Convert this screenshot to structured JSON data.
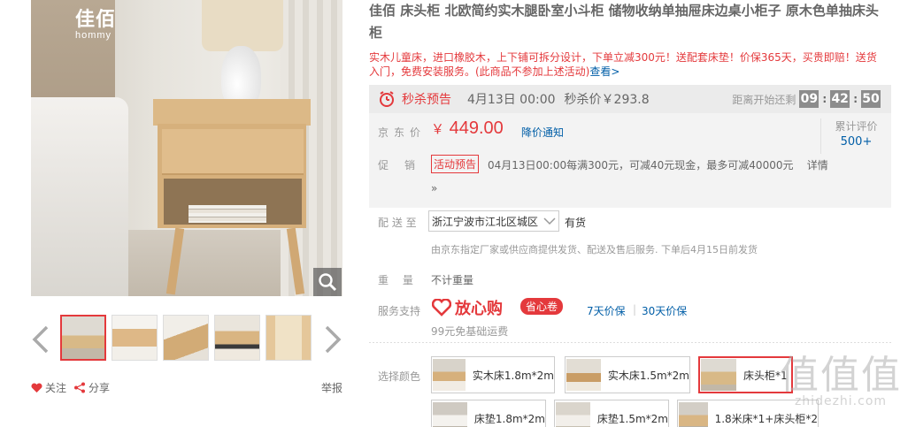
{
  "gallery": {
    "brand_cn": "佳佰",
    "brand_en": "hommy",
    "zoom_icon": "magnifier-icon",
    "prev_icon": "chevron-left-icon",
    "next_icon": "chevron-right-icon"
  },
  "actions": {
    "follow_label": "关注",
    "share_label": "分享",
    "report_label": "举报"
  },
  "product": {
    "title": "佳佰 床头柜 北欧简约实木腿卧室小斗柜 储物收纳单抽屉床边桌小柜子 原木色单抽床头柜",
    "promo_text": "实木儿童床，进口橡胶木，上下铺可拆分设计，下单立减300元！送配套床垫！价保365天，买贵即赔！送货入门，免费安装服务。(此商品不参加上述活动)",
    "promo_link": "查看>"
  },
  "seckill": {
    "label": "秒杀预告",
    "time": "4月13日 00:00",
    "price": "秒杀价￥293.8",
    "countdown_label": "距离开始还剩",
    "hours": "09",
    "minutes": "42",
    "seconds": "50"
  },
  "price": {
    "label": "京东价",
    "currency": "￥",
    "value": "449.00",
    "notify": "降价通知",
    "review_label": "累计评价",
    "review_count": "500+"
  },
  "promotion": {
    "label": "促销",
    "tag": "活动预告",
    "desc": "04月13日00:00每满300元，可减40元现金，最多可减40000元",
    "detail": "详情",
    "more": "»"
  },
  "delivery": {
    "label": "配 送 至",
    "address": "浙江宁波市江北区城区",
    "stock": "有货",
    "note": "由京东指定厂家或供应商提供发货、配送及售后服务. 下单后4月15日前发货"
  },
  "weight": {
    "label": "重　 量",
    "value": "不计重量"
  },
  "service": {
    "label": "服务支持",
    "logo_text": "放心购",
    "badge": "省心卷",
    "link1": "7天价保",
    "link2": "30天价保",
    "free_ship": "99元免基础运费"
  },
  "colors": {
    "label": "选择颜色",
    "options": [
      "实木床1.8m*2m",
      "实木床1.5m*2m",
      "床头柜*1",
      "床垫1.8m*2m",
      "床垫1.5m*2m",
      "1.8米床*1+床头柜*2"
    ]
  },
  "watermark": {
    "big": "值值值",
    "small": "zhidezhi.com"
  },
  "colors_theme": {
    "accent_red": "#e4393c",
    "link_blue": "#005ea7"
  }
}
